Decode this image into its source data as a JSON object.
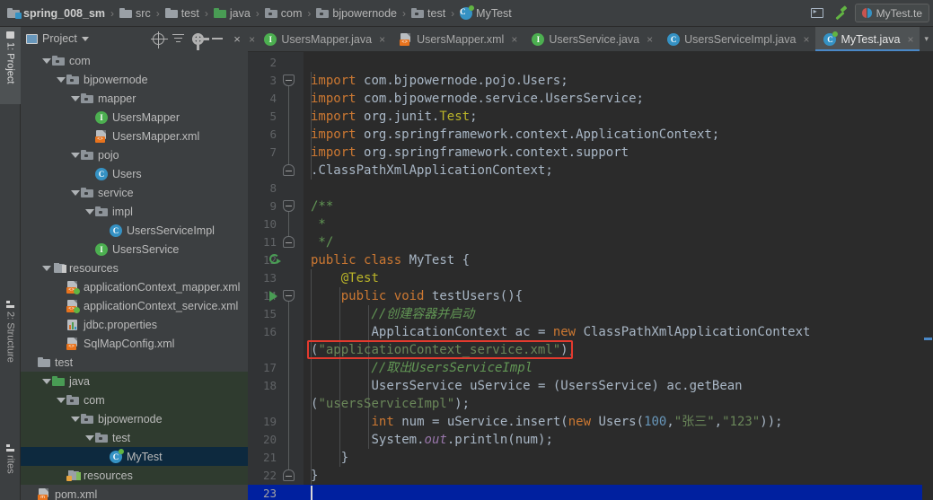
{
  "window": {
    "breadcrumb": [
      {
        "label": "spring_008_sm",
        "icon": "module-icon",
        "bold": true
      },
      {
        "label": "src",
        "icon": "folder-icon",
        "bold": false
      },
      {
        "label": "test",
        "icon": "folder-icon",
        "bold": false
      },
      {
        "label": "java",
        "icon": "source-root-folder-icon",
        "bold": false
      },
      {
        "label": "com",
        "icon": "package-icon",
        "bold": false
      },
      {
        "label": "bjpowernode",
        "icon": "package-icon",
        "bold": false
      },
      {
        "label": "test",
        "icon": "package-icon",
        "bold": false
      },
      {
        "label": "MyTest",
        "icon": "junit-class-icon",
        "bold": false
      }
    ],
    "separator": "›",
    "toolbar_right": {
      "terminal_tooltip": "Terminal",
      "build_tooltip": "Build Project",
      "run_config_label": "MyTest.te"
    }
  },
  "tool_strip": {
    "items": [
      {
        "label": "1: Project",
        "icon": "project-icon",
        "active": true
      },
      {
        "label": "2: Structure",
        "icon": "structure-icon",
        "active": false
      },
      {
        "label": "rites",
        "icon": "favorites-icon",
        "active": false
      }
    ]
  },
  "project_panel": {
    "title": "Project",
    "buttons": [
      {
        "name": "locate-icon",
        "label": ""
      },
      {
        "name": "collapse-all-icon",
        "label": ""
      },
      {
        "name": "settings-gear-icon",
        "label": ""
      },
      {
        "name": "hide-panel-icon",
        "label": ""
      },
      {
        "name": "close-panel-icon",
        "label": "×"
      }
    ],
    "tree": [
      {
        "label": "com",
        "indent": 1,
        "icon": "package-icon",
        "arrow": true,
        "selected": false,
        "test_root": false
      },
      {
        "label": "bjpowernode",
        "indent": 2,
        "icon": "package-icon",
        "arrow": true,
        "selected": false,
        "test_root": false
      },
      {
        "label": "mapper",
        "indent": 3,
        "icon": "package-icon",
        "arrow": true,
        "selected": false,
        "test_root": false
      },
      {
        "label": "UsersMapper",
        "indent": 4,
        "icon": "interface-icon",
        "arrow": false,
        "selected": false,
        "test_root": false
      },
      {
        "label": "UsersMapper.xml",
        "indent": 4,
        "icon": "xml-file-icon",
        "arrow": false,
        "selected": false,
        "test_root": false
      },
      {
        "label": "pojo",
        "indent": 3,
        "icon": "package-icon",
        "arrow": true,
        "selected": false,
        "test_root": false
      },
      {
        "label": "Users",
        "indent": 4,
        "icon": "class-icon",
        "arrow": false,
        "selected": false,
        "test_root": false
      },
      {
        "label": "service",
        "indent": 3,
        "icon": "package-icon",
        "arrow": true,
        "selected": false,
        "test_root": false
      },
      {
        "label": "impl",
        "indent": 4,
        "icon": "package-icon",
        "arrow": true,
        "selected": false,
        "test_root": false
      },
      {
        "label": "UsersServiceImpl",
        "indent": 5,
        "icon": "class-icon",
        "arrow": false,
        "selected": false,
        "test_root": false
      },
      {
        "label": "UsersService",
        "indent": 4,
        "icon": "interface-icon",
        "arrow": false,
        "selected": false,
        "test_root": false
      },
      {
        "label": "resources",
        "indent": 1,
        "icon": "resource-root-icon",
        "arrow": true,
        "selected": false,
        "test_root": false
      },
      {
        "label": "applicationContext_mapper.xml",
        "indent": 2,
        "icon": "spring-xml-icon",
        "arrow": false,
        "selected": false,
        "test_root": false
      },
      {
        "label": "applicationContext_service.xml",
        "indent": 2,
        "icon": "spring-xml-icon",
        "arrow": false,
        "selected": false,
        "test_root": false
      },
      {
        "label": "jdbc.properties",
        "indent": 2,
        "icon": "properties-icon",
        "arrow": false,
        "selected": false,
        "test_root": false
      },
      {
        "label": "SqlMapConfig.xml",
        "indent": 2,
        "icon": "xml-file-icon",
        "arrow": false,
        "selected": false,
        "test_root": false
      },
      {
        "label": "test",
        "indent": 0,
        "icon": "folder-icon",
        "arrow": false,
        "selected": false,
        "test_root": false
      },
      {
        "label": "java",
        "indent": 1,
        "icon": "test-source-root-icon",
        "arrow": true,
        "selected": false,
        "test_root": true
      },
      {
        "label": "com",
        "indent": 2,
        "icon": "package-icon",
        "arrow": true,
        "selected": false,
        "test_root": true
      },
      {
        "label": "bjpowernode",
        "indent": 3,
        "icon": "package-icon",
        "arrow": true,
        "selected": false,
        "test_root": true
      },
      {
        "label": "test",
        "indent": 4,
        "icon": "package-icon",
        "arrow": true,
        "selected": false,
        "test_root": true
      },
      {
        "label": "MyTest",
        "indent": 5,
        "icon": "junit-class-icon",
        "arrow": false,
        "selected": true,
        "test_root": true
      },
      {
        "label": "resources",
        "indent": 2,
        "icon": "test-resource-root-icon",
        "arrow": false,
        "selected": false,
        "test_root": true
      },
      {
        "label": "pom.xml",
        "indent": 0,
        "icon": "maven-xml-icon",
        "arrow": false,
        "selected": false,
        "test_root": false
      }
    ]
  },
  "editor": {
    "tabs": [
      {
        "label": "UsersMapper.java",
        "icon": "interface-icon",
        "active": false
      },
      {
        "label": "UsersMapper.xml",
        "icon": "xml-file-icon",
        "active": false
      },
      {
        "label": "UsersService.java",
        "icon": "interface-icon",
        "active": false
      },
      {
        "label": "UsersServiceImpl.java",
        "icon": "class-icon",
        "active": false
      },
      {
        "label": "MyTest.java",
        "icon": "junit-class-icon",
        "active": true
      }
    ],
    "tab_close_glyph": "×",
    "tabs_overflow_glyph": "▾",
    "line_numbers": [
      2,
      3,
      4,
      5,
      6,
      7,
      8,
      9,
      10,
      11,
      12,
      13,
      14,
      15,
      16,
      17,
      18,
      19,
      20,
      21,
      22,
      23
    ],
    "current_line": 23,
    "cursor_line": 23,
    "gutter": {
      "run_class_line": 12,
      "run_method_line": 14
    },
    "annotation": {
      "type": "red-rectangle-highlight",
      "color": "#e33a2e",
      "target_text": "(\"applicationContext_service.xml\")"
    },
    "code_lines": [
      {
        "n": 2,
        "text": ""
      },
      {
        "n": 3,
        "text": "import com.bjpowernode.pojo.Users;"
      },
      {
        "n": 4,
        "text": "import com.bjpowernode.service.UsersService;"
      },
      {
        "n": 5,
        "text": "import org.junit.Test;"
      },
      {
        "n": 6,
        "text": "import org.springframework.context.ApplicationContext;"
      },
      {
        "n": 7,
        "text": "import org.springframework.context.support"
      },
      {
        "n": 7.5,
        "text": ".ClassPathXmlApplicationContext;"
      },
      {
        "n": 8,
        "text": ""
      },
      {
        "n": 9,
        "text": "/**"
      },
      {
        "n": 10,
        "text": " *"
      },
      {
        "n": 11,
        "text": " */"
      },
      {
        "n": 12,
        "text": "public class MyTest {"
      },
      {
        "n": 13,
        "text": "    @Test"
      },
      {
        "n": 14,
        "text": "    public void testUsers(){"
      },
      {
        "n": 15,
        "text": "        //创建容器并启动"
      },
      {
        "n": 16,
        "text": "        ApplicationContext ac = new ClassPathXmlApplicationContext"
      },
      {
        "n": 16.5,
        "text": "(\"applicationContext_service.xml\");"
      },
      {
        "n": 17,
        "text": "        //取出UsersServiceImpl"
      },
      {
        "n": 18,
        "text": "        UsersService uService = (UsersService) ac.getBean"
      },
      {
        "n": 18.5,
        "text": "(\"usersServiceImpl\");"
      },
      {
        "n": 19,
        "text": "        int num = uService.insert(new Users(100,\"张三\",\"123\"));"
      },
      {
        "n": 20,
        "text": "        System.out.println(num);"
      },
      {
        "n": 21,
        "text": "    }"
      },
      {
        "n": 22,
        "text": "}"
      },
      {
        "n": 23,
        "text": ""
      }
    ]
  },
  "colors": {
    "keyword": "#cc7832",
    "string": "#6a8759",
    "number": "#6897bb",
    "comment": "#629755",
    "annotation": "#bbb529",
    "text": "#a9b7c6",
    "static_field": "#9876aa",
    "editor_bg": "#2b2b2b",
    "panel_bg": "#3c3f41",
    "selection": "#0d293e",
    "current_line": "#00209f",
    "test_root": "#2f3b2f",
    "accent": "#4a88c7",
    "highlight_box": "#e33a2e"
  }
}
